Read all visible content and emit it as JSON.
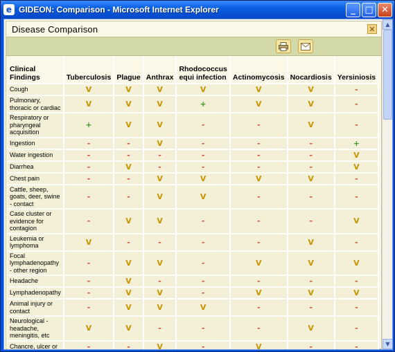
{
  "window": {
    "title": "GIDEON: Comparison - Microsoft Internet Explorer",
    "minimize_glyph": "_",
    "maximize_glyph": "□",
    "close_glyph": "✕"
  },
  "panel": {
    "title": "Disease Comparison",
    "close_glyph": "✕",
    "print_icon": "printer-icon",
    "email_icon": "envelope-icon"
  },
  "table": {
    "findings_header": "Clinical Findings",
    "diseases": [
      "Tuberculosis",
      "Plague",
      "Anthrax",
      "Rhodococcus equi infection",
      "Actinomycosis",
      "Nocardiosis",
      "Yersiniosis"
    ],
    "rows": [
      {
        "finding": "Cough",
        "values": [
          "v",
          "v",
          "v",
          "v",
          "v",
          "v",
          "-"
        ]
      },
      {
        "finding": "Pulmonary, thoracic or cardiac",
        "values": [
          "v",
          "v",
          "v",
          "+",
          "v",
          "v",
          "-"
        ]
      },
      {
        "finding": "Respiratory or pharyngeal acquisition",
        "values": [
          "+",
          "v",
          "v",
          "-",
          "-",
          "v",
          "-"
        ]
      },
      {
        "finding": "Ingestion",
        "values": [
          "-",
          "-",
          "v",
          "-",
          "-",
          "-",
          "+"
        ]
      },
      {
        "finding": "Water ingestion",
        "values": [
          "-",
          "-",
          "-",
          "-",
          "-",
          "-",
          "v"
        ]
      },
      {
        "finding": "Diarrhea",
        "values": [
          "-",
          "v",
          "-",
          "-",
          "-",
          "-",
          "v"
        ]
      },
      {
        "finding": "Chest pain",
        "values": [
          "-",
          "-",
          "v",
          "v",
          "v",
          "v",
          "-"
        ]
      },
      {
        "finding": "Cattle, sheep, goats, deer, swine - contact",
        "values": [
          "-",
          "-",
          "v",
          "v",
          "-",
          "-",
          "-"
        ]
      },
      {
        "finding": "Case cluster or evidence for contagion",
        "values": [
          "-",
          "v",
          "v",
          "-",
          "-",
          "-",
          "v"
        ]
      },
      {
        "finding": "Leukemia or lymphoma",
        "values": [
          "v",
          "-",
          "-",
          "-",
          "-",
          "v",
          "-"
        ]
      },
      {
        "finding": "Focal lymphadenopathy - other region",
        "values": [
          "-",
          "v",
          "v",
          "-",
          "v",
          "v",
          "v"
        ]
      },
      {
        "finding": "Headache",
        "values": [
          "-",
          "v",
          "-",
          "-",
          "-",
          "-",
          "-"
        ]
      },
      {
        "finding": "Lymphadenopathy",
        "values": [
          "-",
          "v",
          "v",
          "-",
          "v",
          "v",
          "v"
        ]
      },
      {
        "finding": "Animal injury or contact",
        "values": [
          "-",
          "v",
          "v",
          "v",
          "-",
          "-",
          "-"
        ]
      },
      {
        "finding": "Neurological - headache, meningitis, etc",
        "values": [
          "v",
          "v",
          "-",
          "-",
          "-",
          "v",
          "-"
        ]
      },
      {
        "finding": "Chancre, ulcer or",
        "values": [
          "-",
          "-",
          "v",
          "-",
          "v",
          "-",
          "-"
        ]
      }
    ]
  }
}
